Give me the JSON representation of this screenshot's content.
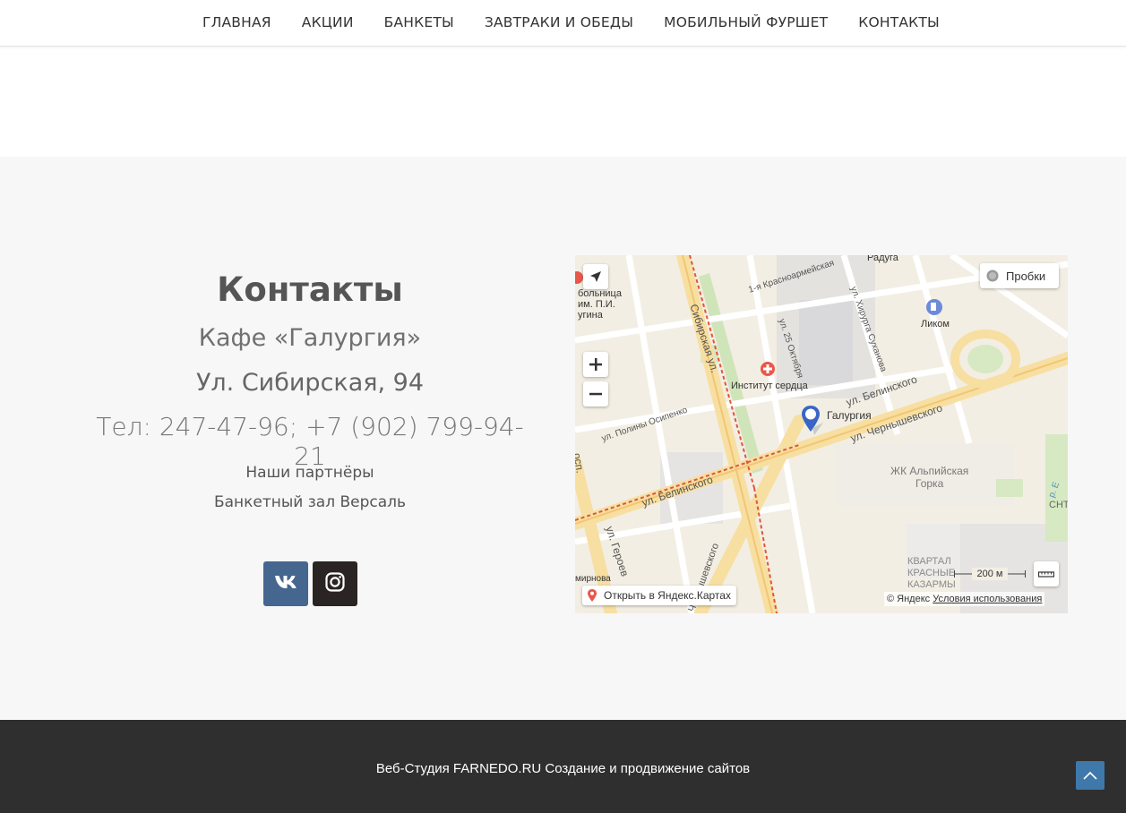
{
  "nav": {
    "items": [
      "ГЛАВНАЯ",
      "АКЦИИ",
      "БАНКЕТЫ",
      "ЗАВТРАКИ И ОБЕДЫ",
      "МОБИЛЬНЫЙ ФУРШЕТ",
      "КОНТАКТЫ"
    ]
  },
  "contacts": {
    "title": "Контакты",
    "cafe": "Кафе «Галургия»",
    "street": "Ул. Сибирская, 94",
    "phone": "Тел: 247-47-96; +7 (902) 799-94-21",
    "partners_link": "Наши партнёры",
    "banquet_link": "Банкетный зал Версаль"
  },
  "social": {
    "vk_icon": "vk-icon",
    "instagram_icon": "instagram-icon",
    "vk_color": "#45668e",
    "instagram_color": "#2a2422"
  },
  "map": {
    "traffic_label": "Пробки",
    "open_in_yandex": "Открыть в Яндекс.Картах",
    "copyright": "© Яндекс",
    "terms": "Условия использования",
    "scale": "200 м",
    "marker_label": "Галургия",
    "labels": {
      "raduga": "Радуга",
      "likom": "Ликом",
      "heart_institute": "Институт сердца",
      "hospital": [
        "больница",
        "им. П.И.",
        "угина"
      ],
      "alpine": [
        "ЖК Альпийская",
        "Горка"
      ],
      "barracks": [
        "КВАРТАЛ",
        "КРАСНЫЕ",
        "КАЗАРМЫ"
      ],
      "sibirskaya": "Сибирская ул.",
      "krasnoarmeyskaya": "1-я Красноармейская",
      "hirurga": "ул. Хирурга Суханова",
      "oktyabrya": "ул. 25 Октября",
      "belinskogo_top": "ул. Белинского",
      "chernyshevskogo_top": "ул. Чернышевского",
      "osipenko": "ул. Полины Осипенко",
      "belinskogo_bottom": "ул. Белинского",
      "chernyshevskogo_bottom": "Чернышевского",
      "geroev": "ул. Героев",
      "prosp": "осп.",
      "smirnova": "мирнова",
      "river": "р. Е",
      "snt": "СНТ"
    }
  },
  "footer": {
    "text": "Веб-Студия FARNEDO.RU Создание и продвижение сайтов"
  },
  "colors": {
    "footer_bg": "#2f2f2f",
    "section_bg": "#f7f7f7",
    "scroll_top": "#3f78ab"
  }
}
